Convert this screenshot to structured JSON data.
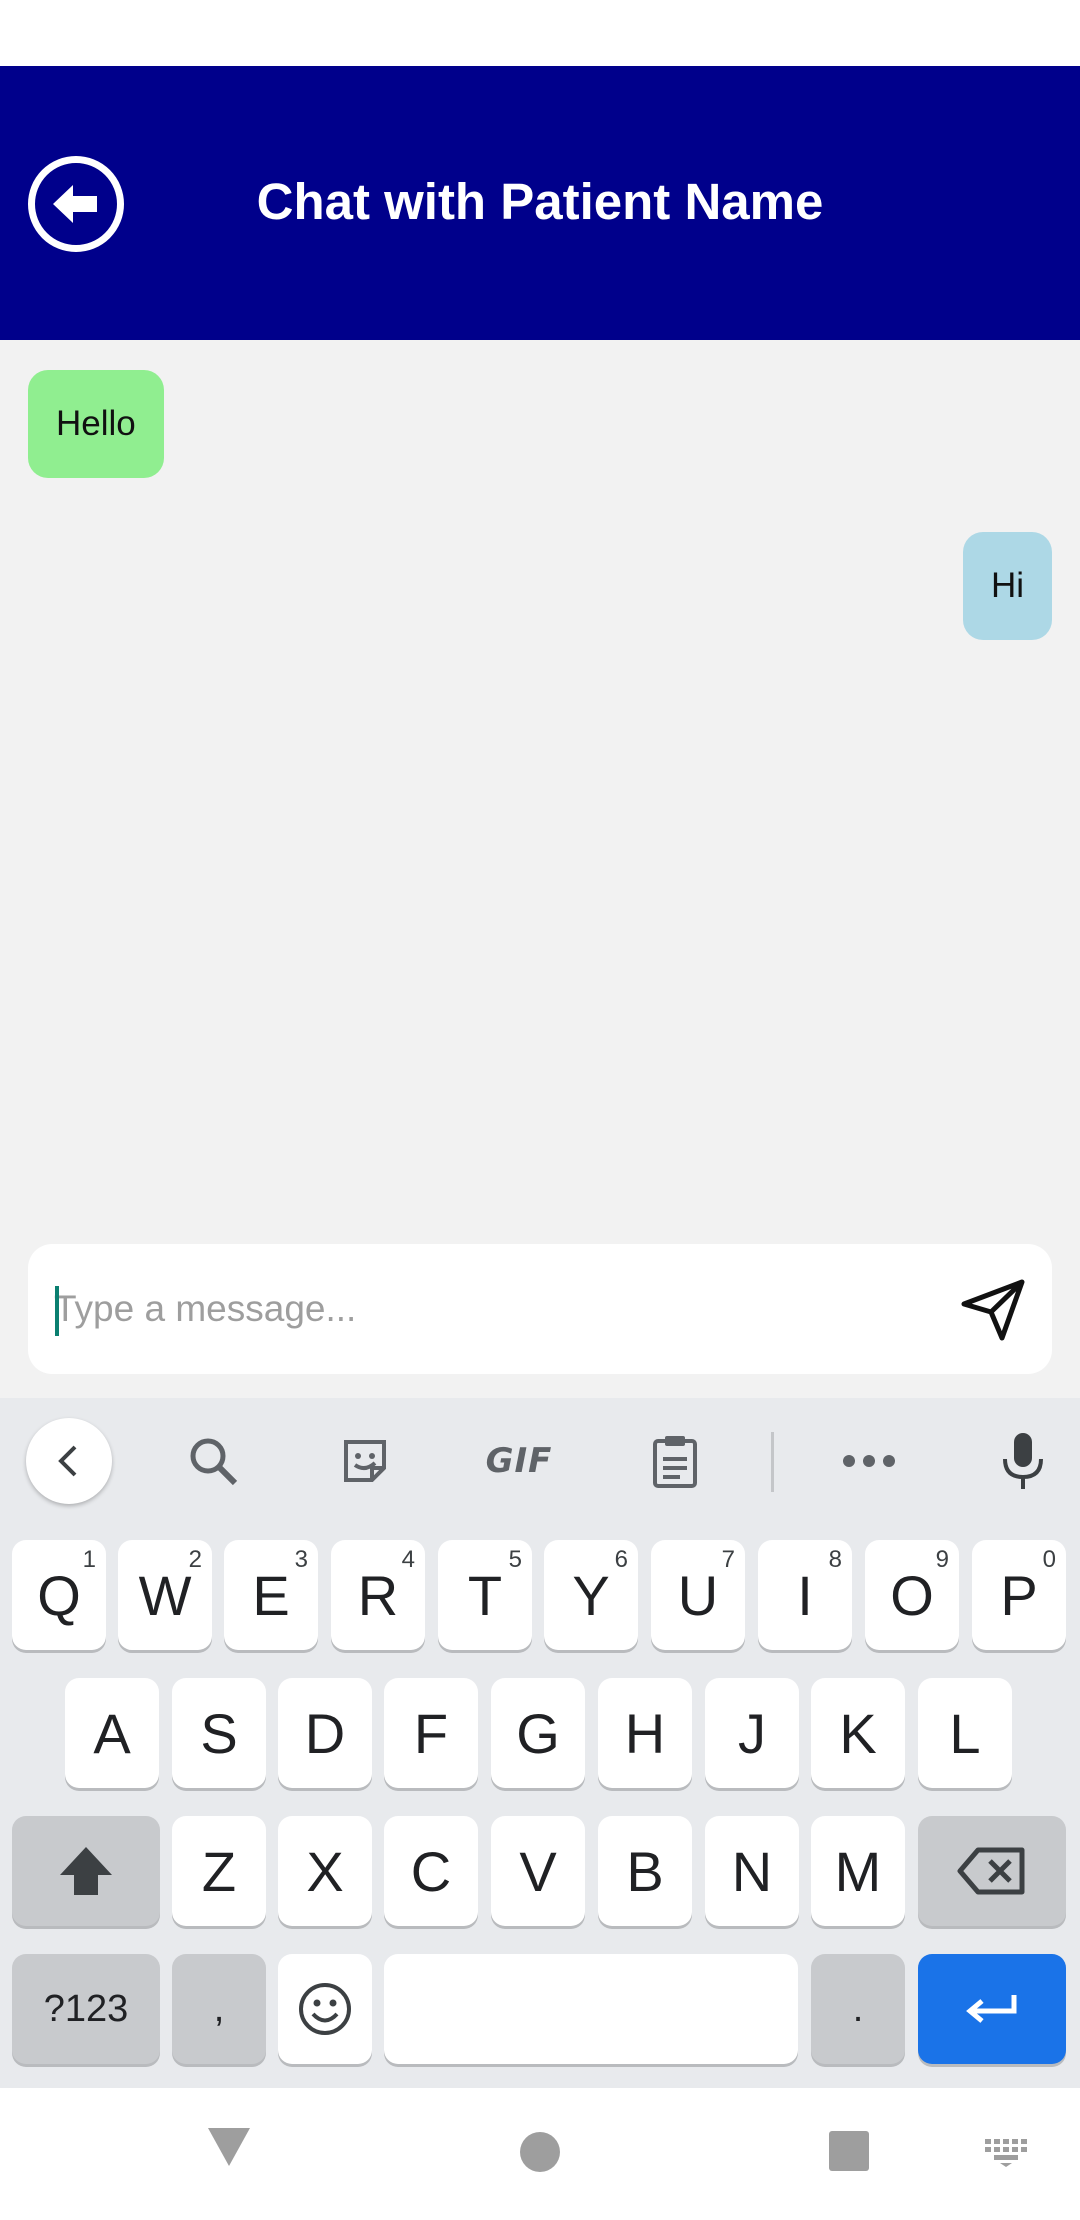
{
  "header": {
    "title": "Chat with Patient Name"
  },
  "messages": [
    {
      "text": "Hello",
      "direction": "incoming",
      "color": "#90ee90"
    },
    {
      "text": "Hi",
      "direction": "outgoing",
      "color": "#add8e6"
    }
  ],
  "composer": {
    "placeholder": "Type a message...",
    "value": ""
  },
  "keyboard": {
    "toolbar": {
      "gif_label": "GIF"
    },
    "row1": [
      {
        "label": "Q",
        "hint": "1"
      },
      {
        "label": "W",
        "hint": "2"
      },
      {
        "label": "E",
        "hint": "3"
      },
      {
        "label": "R",
        "hint": "4"
      },
      {
        "label": "T",
        "hint": "5"
      },
      {
        "label": "Y",
        "hint": "6"
      },
      {
        "label": "U",
        "hint": "7"
      },
      {
        "label": "I",
        "hint": "8"
      },
      {
        "label": "O",
        "hint": "9"
      },
      {
        "label": "P",
        "hint": "0"
      }
    ],
    "row2": [
      "A",
      "S",
      "D",
      "F",
      "G",
      "H",
      "J",
      "K",
      "L"
    ],
    "row3": [
      "Z",
      "X",
      "C",
      "V",
      "B",
      "N",
      "M"
    ],
    "row4": {
      "symbols": "?123",
      "comma": ",",
      "period": "."
    }
  },
  "colors": {
    "header_bg": "#00008b",
    "enter_key": "#1a73e8",
    "app_bg": "#f2f2f2"
  }
}
